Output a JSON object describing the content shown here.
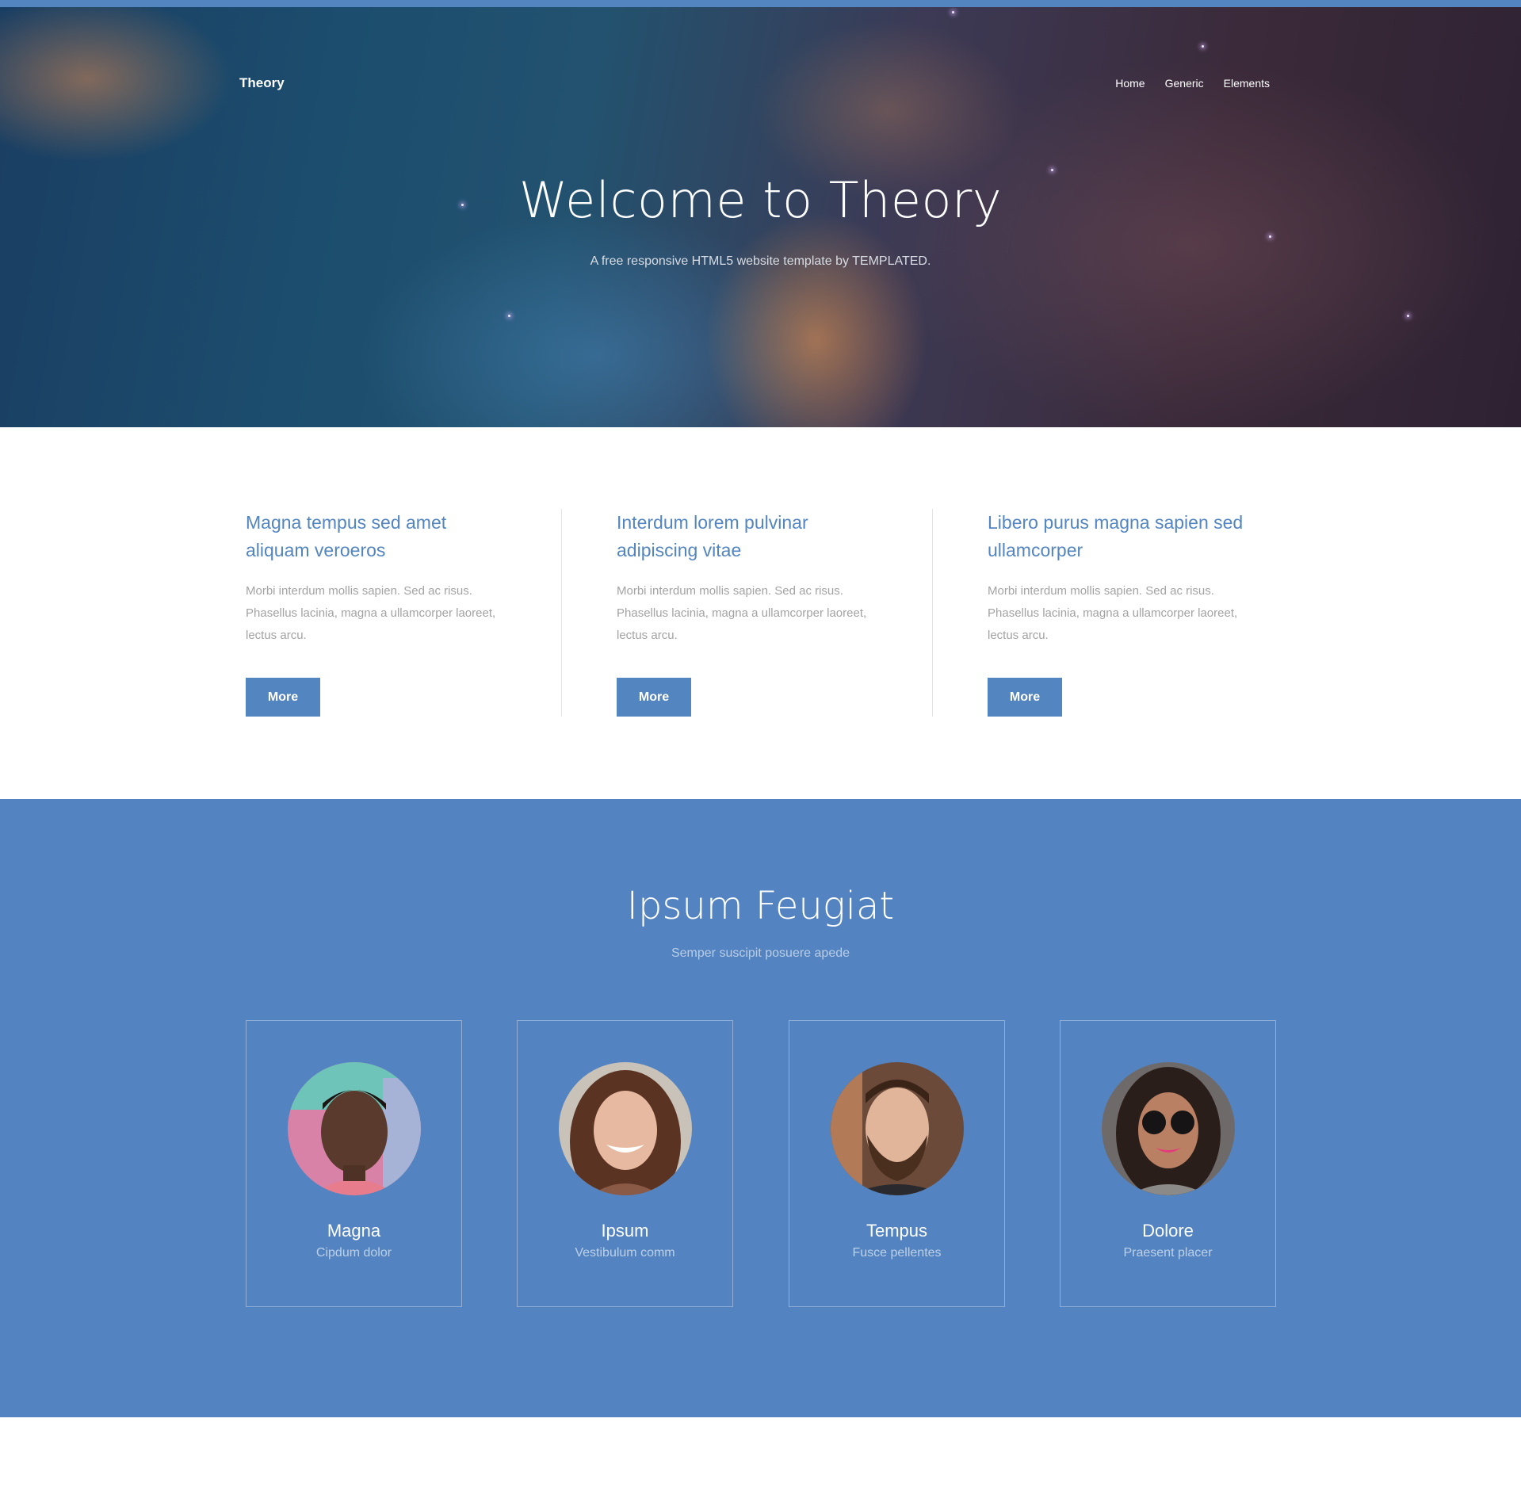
{
  "header": {
    "brand": "Theory",
    "nav": [
      "Home",
      "Generic",
      "Elements"
    ]
  },
  "hero": {
    "title": "Welcome to Theory",
    "subtitle": "A free responsive HTML5 website template by TEMPLATED."
  },
  "features": [
    {
      "title": "Magna tempus sed amet aliquam veroeros",
      "text": "Morbi interdum mollis sapien. Sed ac risus. Phasellus lacinia, magna a ullamcorper laoreet, lectus arcu.",
      "button": "More"
    },
    {
      "title": "Interdum lorem pulvinar adipiscing vitae",
      "text": "Morbi interdum mollis sapien. Sed ac risus. Phasellus lacinia, magna a ullamcorper laoreet, lectus arcu.",
      "button": "More"
    },
    {
      "title": "Libero purus magna sapien sed ullamcorper",
      "text": "Morbi interdum mollis sapien. Sed ac risus. Phasellus lacinia, magna a ullamcorper laoreet, lectus arcu.",
      "button": "More"
    }
  ],
  "team": {
    "title": "Ipsum Feugiat",
    "subtitle": "Semper suscipit posuere apede",
    "members": [
      {
        "name": "Magna",
        "role": "Cipdum dolor"
      },
      {
        "name": "Ipsum",
        "role": "Vestibulum comm"
      },
      {
        "name": "Tempus",
        "role": "Fusce pellentes"
      },
      {
        "name": "Dolore",
        "role": "Praesent placer"
      }
    ]
  },
  "colors": {
    "accent": "#5385c1",
    "muted_text": "#a3a3a3"
  }
}
